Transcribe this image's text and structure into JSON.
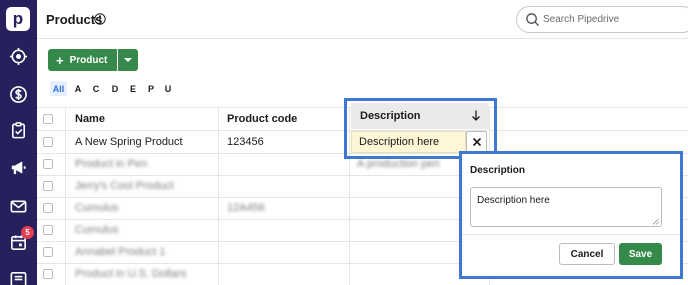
{
  "app": {
    "logo_letter": "p"
  },
  "sidebar": {
    "items": [
      {
        "icon": "target-icon"
      },
      {
        "icon": "dollar-icon"
      },
      {
        "icon": "clipboard-check-icon"
      },
      {
        "icon": "megaphone-icon"
      },
      {
        "icon": "mail-icon"
      },
      {
        "icon": "calendar-icon",
        "badge": "5"
      },
      {
        "icon": "contacts-card-icon"
      }
    ]
  },
  "header": {
    "title": "Products",
    "search_placeholder": "Search Pipedrive"
  },
  "toolbar": {
    "add_label": "Product",
    "add_icon": "+"
  },
  "alphabet": {
    "letters": [
      "All",
      "A",
      "C",
      "D",
      "E",
      "P",
      "U"
    ],
    "selected": "All"
  },
  "table": {
    "columns": [
      "Name",
      "Product code",
      "Description"
    ],
    "rows": [
      {
        "name": "A New Spring Product",
        "code": "123456",
        "description": "Description here",
        "blurred": false
      },
      {
        "name": "Product in Pen",
        "code": "",
        "description": "A production pen",
        "blurred": true
      },
      {
        "name": "Jerry's Cool Product",
        "code": "",
        "description": "",
        "blurred": true
      },
      {
        "name": "Cumulus",
        "code": "12A456",
        "description": "",
        "blurred": true
      },
      {
        "name": "Cumulus",
        "code": "",
        "description": "",
        "blurred": true
      },
      {
        "name": "Annabel Product 1",
        "code": "",
        "description": "",
        "blurred": true
      },
      {
        "name": "Product in U.S. Dollars",
        "code": "",
        "description": "",
        "blurred": true
      }
    ]
  },
  "popup": {
    "title": "Description",
    "value": "Description here",
    "cancel_label": "Cancel",
    "save_label": "Save"
  },
  "colors": {
    "sidebar": "#26215c",
    "primary_green": "#368a49",
    "highlight_blue": "#3f78d1",
    "edit_cell_bg": "#fff6d6",
    "badge_red": "#e03d4e"
  }
}
